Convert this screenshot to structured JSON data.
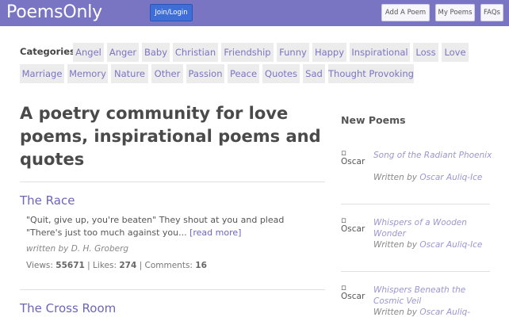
{
  "header": {
    "logo": "PoemsOnly",
    "join_label": "Join/Login",
    "add_label": "Add A Poem",
    "my_label": "My Poems",
    "faq_label": "FAQs"
  },
  "categories": {
    "label": "Categories:",
    "items": [
      "Angel",
      "Anger",
      "Baby",
      "Christian",
      "Friendship",
      "Funny",
      "Happy",
      "Inspirational",
      "Loss",
      "Love",
      "Marriage",
      "Memory",
      "Nature",
      "Other",
      "Passion",
      "Peace",
      "Quotes",
      "Sad",
      "Thought Provoking"
    ]
  },
  "main": {
    "headline": "A poetry community for love poems, inspirational poems and quotes",
    "poems": [
      {
        "title": "The Race",
        "excerpt": "\"Quit, give up, you're beaten\" They shout at you and plead \"There's just too much against you...",
        "read_more": "[read more]",
        "author_prefix": "written by",
        "author": "D. H. Groberg",
        "views_label": "Views:",
        "views": "55671",
        "likes_label": "Likes:",
        "likes": "274",
        "comments_label": "Comments:",
        "comments": "16"
      },
      {
        "title": "The Cross Room"
      }
    ]
  },
  "sidebar": {
    "title": "New Poems",
    "items": [
      {
        "img_alt": "Oscar",
        "title": "Song of the Radiant Phoenix",
        "by_prefix": "Written by",
        "author": "Oscar Auliq-Ice"
      },
      {
        "img_alt": "Oscar",
        "title": "Whispers of a Wooden Wonder",
        "by_prefix": "Written by",
        "author": "Oscar Auliq-Ice"
      },
      {
        "img_alt": "Oscar",
        "title": "Whispers Beneath the Cosmic Veil",
        "by_prefix": "Written by",
        "author": "Oscar Auliq-"
      }
    ]
  },
  "colors": {
    "header_bg": "#7a75c3",
    "join_bg": "#3f6fd6",
    "link": "#6b66b8",
    "chip_bg": "#ececec"
  }
}
